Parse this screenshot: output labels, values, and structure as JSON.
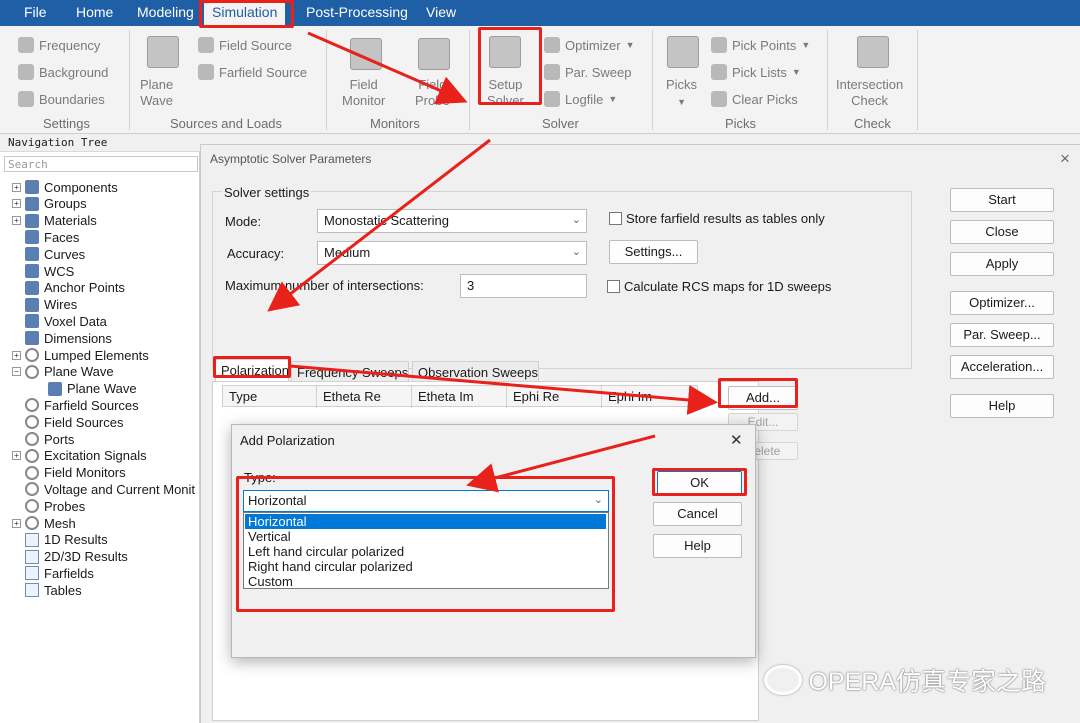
{
  "menubar": {
    "file": "File",
    "home": "Home",
    "modeling": "Modeling",
    "simulation": "Simulation",
    "post": "Post-Processing",
    "view": "View"
  },
  "ribbon": {
    "settings": {
      "items": [
        "Frequency",
        "Background",
        "Boundaries"
      ],
      "group": "Settings"
    },
    "sources": {
      "plane_wave": "Plane\nWave",
      "field_source": "Field Source",
      "farfield_source": "Farfield Source",
      "group": "Sources and Loads"
    },
    "monitors": {
      "field_monitor": "Field\nMonitor",
      "field_probe": "Field\nProbe",
      "group": "Monitors"
    },
    "solver": {
      "setup": "Setup\nSolver",
      "optimizer": "Optimizer",
      "par_sweep": "Par. Sweep",
      "logfile": "Logfile",
      "group": "Solver"
    },
    "picks": {
      "picks": "Picks",
      "pick_points": "Pick Points",
      "pick_lists": "Pick Lists",
      "clear_picks": "Clear Picks",
      "group": "Picks"
    },
    "check": {
      "intersection": "Intersection\nCheck",
      "group": "Check"
    }
  },
  "navtree": {
    "title": "Navigation Tree",
    "search": "Search",
    "items": [
      "Components",
      "Groups",
      "Materials",
      "Faces",
      "Curves",
      "WCS",
      "Anchor Points",
      "Wires",
      "Voxel Data",
      "Dimensions",
      "Lumped Elements",
      "Plane Wave",
      "Plane Wave",
      "Farfield Sources",
      "Field Sources",
      "Ports",
      "Excitation Signals",
      "Field Monitors",
      "Voltage and Current Monit",
      "Probes",
      "Mesh",
      "1D Results",
      "2D/3D Results",
      "Farfields",
      "Tables"
    ]
  },
  "dialog": {
    "title": "Asymptotic Solver Parameters",
    "close": "×",
    "solver_settings": "Solver settings",
    "mode_label": "Mode:",
    "mode_value": "Monostatic Scattering",
    "accuracy_label": "Accuracy:",
    "accuracy_value": "Medium",
    "max_label": "Maximum number of intersections:",
    "max_value": "3",
    "store_farfield": "Store farfield results as tables only",
    "settings_btn": "Settings...",
    "calc_rcs": "Calculate RCS maps for 1D sweeps",
    "buttons": {
      "start": "Start",
      "close": "Close",
      "apply": "Apply",
      "optimizer": "Optimizer...",
      "par_sweep": "Par. Sweep...",
      "acceleration": "Acceleration...",
      "help": "Help"
    },
    "tabs": [
      "Polarization",
      "Frequency Sweeps",
      "Observation Sweeps"
    ],
    "columns": [
      "Type",
      "Etheta Re",
      "Etheta Im",
      "Ephi Re",
      "Ephi Im"
    ],
    "table_btns": {
      "add": "Add...",
      "edit": "Edit...",
      "delete": "Delete"
    }
  },
  "add_polarization": {
    "title": "Add Polarization",
    "close": "✕",
    "type_label": "Type:",
    "selected": "Horizontal",
    "options": [
      "Horizontal",
      "Vertical",
      "Left hand circular polarized",
      "Right hand circular polarized",
      "Custom"
    ],
    "ok": "OK",
    "cancel": "Cancel",
    "help": "Help"
  },
  "watermark": {
    "text": "OPERA仿真专家之路"
  },
  "colors": {
    "menubar": "#1f5fa6",
    "highlight": "#e8211a",
    "selection": "#0078d7"
  }
}
